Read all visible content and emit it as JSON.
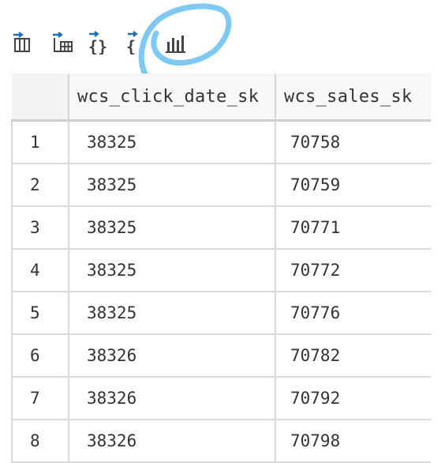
{
  "toolbar": {
    "buttons": [
      {
        "name": "export-table-icon"
      },
      {
        "name": "export-excel-icon"
      },
      {
        "name": "export-json-icon"
      },
      {
        "name": "copy-json-icon"
      },
      {
        "name": "bar-chart-icon"
      }
    ],
    "highlight_color": "#7ec8f5"
  },
  "table": {
    "columns": [
      "",
      "wcs_click_date_sk",
      "wcs_sales_sk"
    ],
    "rows": [
      {
        "index": "1",
        "wcs_click_date_sk": "38325",
        "wcs_sales_sk": "70758"
      },
      {
        "index": "2",
        "wcs_click_date_sk": "38325",
        "wcs_sales_sk": "70759"
      },
      {
        "index": "3",
        "wcs_click_date_sk": "38325",
        "wcs_sales_sk": "70771"
      },
      {
        "index": "4",
        "wcs_click_date_sk": "38325",
        "wcs_sales_sk": "70772"
      },
      {
        "index": "5",
        "wcs_click_date_sk": "38325",
        "wcs_sales_sk": "70776"
      },
      {
        "index": "6",
        "wcs_click_date_sk": "38326",
        "wcs_sales_sk": "70782"
      },
      {
        "index": "7",
        "wcs_click_date_sk": "38326",
        "wcs_sales_sk": "70792"
      },
      {
        "index": "8",
        "wcs_click_date_sk": "38326",
        "wcs_sales_sk": "70798"
      }
    ]
  }
}
